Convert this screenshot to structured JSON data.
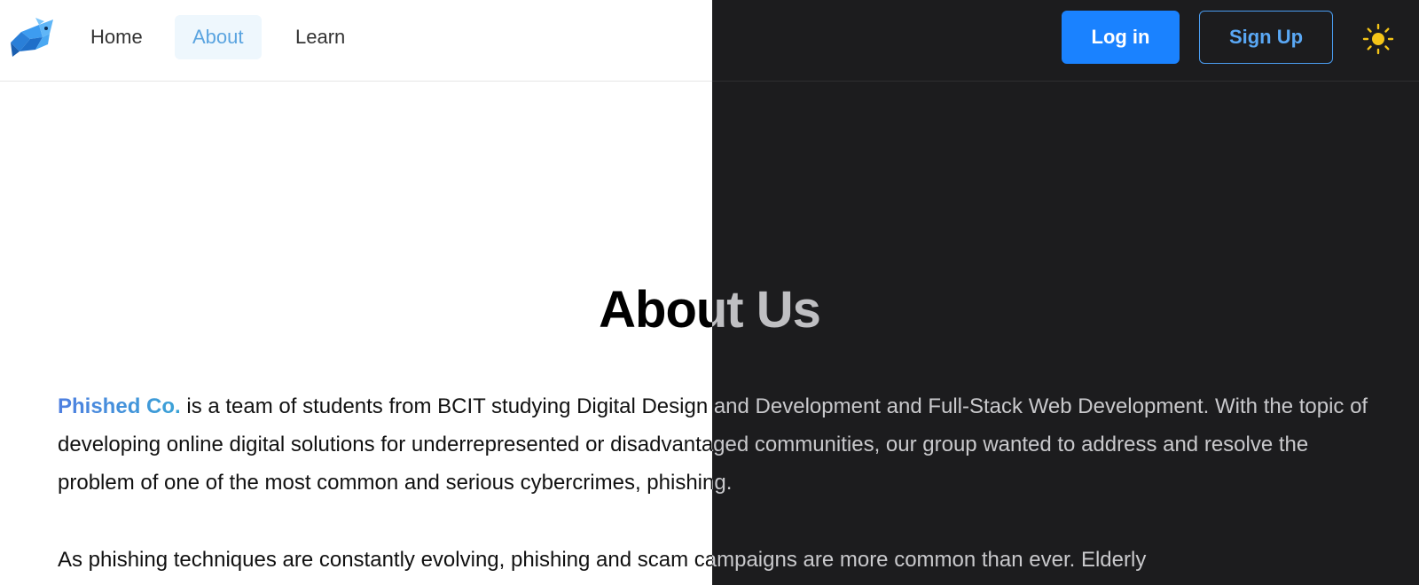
{
  "nav": {
    "logo_icon": "fish-logo-icon",
    "links": [
      {
        "label": "Home"
      },
      {
        "label": "About"
      },
      {
        "label": "Learn"
      }
    ],
    "active_link": "About",
    "login_label": "Log in",
    "signup_label": "Sign Up",
    "theme_icon": "sun-icon"
  },
  "content": {
    "title": "About Us",
    "brand_name": "Phished Co.",
    "paragraph1_rest": " is a team of students from BCIT studying Digital Design and Development and Full-Stack Web Development. With the topic of developing online digital solutions for underrepresented or disadvantaged communities, our group wanted to address and resolve the problem of one of the most common and serious cybercrimes, phishing.",
    "paragraph2": "As phishing techniques are constantly evolving, phishing and scam campaigns are more common than ever. Elderly"
  },
  "colors": {
    "accent": "#1a82ff",
    "accent_outline": "#4a9cf0",
    "brand_gradient_start": "#4f7fe0",
    "brand_gradient_end": "#3aa3d6",
    "dark_background": "#1c1c1e",
    "light_background": "#ffffff",
    "sun": "#f5c518"
  }
}
